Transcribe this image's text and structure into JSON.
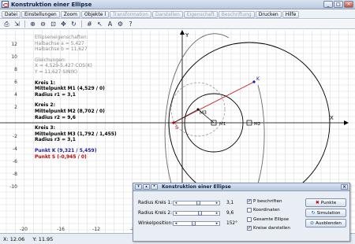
{
  "window": {
    "title": "Konstruktion einer Ellipse"
  },
  "menu": [
    {
      "label": "Datei",
      "disabled": false
    },
    {
      "label": "Einstellungen",
      "disabled": false
    },
    {
      "label": "Zoom",
      "disabled": false
    },
    {
      "label": "Objekte l",
      "disabled": false
    },
    {
      "label": "Transformation",
      "disabled": true
    },
    {
      "label": "Darstellen",
      "disabled": true
    },
    {
      "label": "Eigenschaft",
      "disabled": true
    },
    {
      "label": "Beschriftung",
      "disabled": true
    },
    {
      "label": "Drucken",
      "disabled": false
    },
    {
      "label": "Hilfe",
      "disabled": false
    }
  ],
  "info": {
    "heading": "Ellipseneigenschaften:",
    "halbachse_a": "Halbachse a = 5,427",
    "halbachse_b": "Halbachse b = 11,627",
    "gleichungen": "Gleichungen:",
    "eq_x": "X = 4,529-5,427·COS(K)",
    "eq_y": "Y = 11,627·SIN(K)",
    "k1_title": "Kreis 1:",
    "k1_m": "Mittelpunkt M1 (4,529 / 0)",
    "k1_r": "Radius r1 = 3,1",
    "k2_title": "Kreis 2:",
    "k2_m": "Mittelpunkt M2 (8,702 / 0)",
    "k2_r": "Radius r2 = 9,6",
    "k3_title": "Kreis 3:",
    "k3_m": "Mittelpunkt M3 (1,792 / 1,455)",
    "k3_r": "Radius r3 = 3,1",
    "punkt_k": "Punkt K (9,321 / 5,459)",
    "punkt_s": "Punkt S (-0,945 / 0)"
  },
  "axes": {
    "x_label": "X",
    "y_label": "Y",
    "y_ticks": [
      "12",
      "10",
      "8",
      "6",
      "4",
      "2",
      "-2",
      "-4",
      "-6",
      "-8",
      "-10"
    ],
    "x_ticks": [
      "-20",
      "-16",
      "-12",
      "-8"
    ]
  },
  "plot_labels": {
    "k": "K",
    "s": "S",
    "m3": "M3",
    "m1": "M1",
    "m2": "M2"
  },
  "status": {
    "x": "X: 12.06",
    "y": "Y: 11.95"
  },
  "dialog": {
    "title": "Konstruktion einer Ellipse",
    "sliders": [
      {
        "label": "Radius Kreis 1:",
        "value": "3,1",
        "fraction": 0.55
      },
      {
        "label": "Radius Kreis 2:",
        "value": "9,6",
        "fraction": 0.62
      },
      {
        "label": "Winkelposition:",
        "value": "152°",
        "fraction": 0.42
      }
    ],
    "checkboxes": [
      {
        "label": "P beschriften",
        "checked": true
      },
      {
        "label": "Koordinaten",
        "checked": false
      },
      {
        "label": "Gesamte Ellipse",
        "checked": false
      },
      {
        "label": "Kreise darstellen",
        "checked": true
      }
    ],
    "buttons": [
      {
        "label": "Punkte"
      },
      {
        "label": "Simulation"
      },
      {
        "label": "Ausblenden"
      }
    ]
  },
  "colors": {
    "ellipse": "#6a6a6a",
    "circle": "#000000",
    "dashed_circle": "#9a9a9a",
    "radius_line": "#c02020",
    "grid": "#d8d8d8"
  }
}
